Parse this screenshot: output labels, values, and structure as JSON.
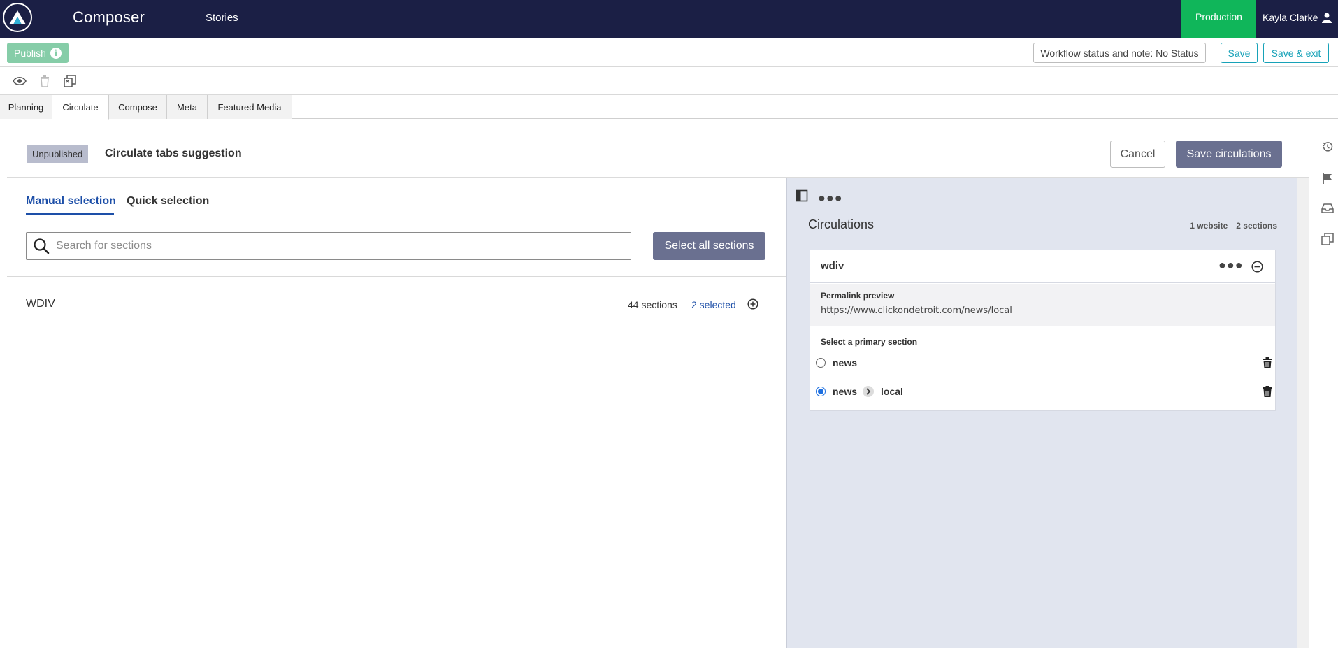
{
  "topnav": {
    "app_title": "Composer",
    "stories_label": "Stories",
    "environment": "Production",
    "user_name": "Kayla Clarke",
    "bg_color": "#1b1f45",
    "env_color": "#10b65a"
  },
  "actionbar": {
    "publish_label": "Publish",
    "workflow_label": "Workflow status and note: No Status",
    "save_label": "Save",
    "save_exit_label": "Save & exit"
  },
  "iconbar": {
    "icons": [
      "eye-icon",
      "trash-icon",
      "copy-icon"
    ]
  },
  "tabs": [
    {
      "label": "Planning",
      "active": false
    },
    {
      "label": "Circulate",
      "active": true
    },
    {
      "label": "Compose",
      "active": false
    },
    {
      "label": "Meta",
      "active": false
    },
    {
      "label": "Featured Media",
      "active": false
    }
  ],
  "header": {
    "status": "Unpublished",
    "title": "Circulate tabs suggestion",
    "cancel_label": "Cancel",
    "save_circulations_label": "Save circulations"
  },
  "left": {
    "subtabs": [
      {
        "label": "Manual selection",
        "active": true
      },
      {
        "label": "Quick selection",
        "active": false
      }
    ],
    "search_placeholder": "Search for sections",
    "select_all_label": "Select all sections",
    "sites": [
      {
        "name": "WDIV",
        "sections_count": "44 sections",
        "selected": "2 selected"
      }
    ]
  },
  "right": {
    "title": "Circulations",
    "websites_count": "1 website",
    "sections_count": "2 sections",
    "card": {
      "site": "wdiv",
      "permalink_label": "Permalink preview",
      "permalink_url": "https://www.clickondetroit.com/news/local",
      "primary_label": "Select a primary section",
      "sections": [
        {
          "parts": [
            "news"
          ],
          "checked": false
        },
        {
          "parts": [
            "news",
            "local"
          ],
          "checked": true
        }
      ]
    }
  },
  "rightrail": {
    "icons": [
      "history-icon",
      "flag-icon",
      "inbox-icon",
      "copy-icon"
    ]
  }
}
